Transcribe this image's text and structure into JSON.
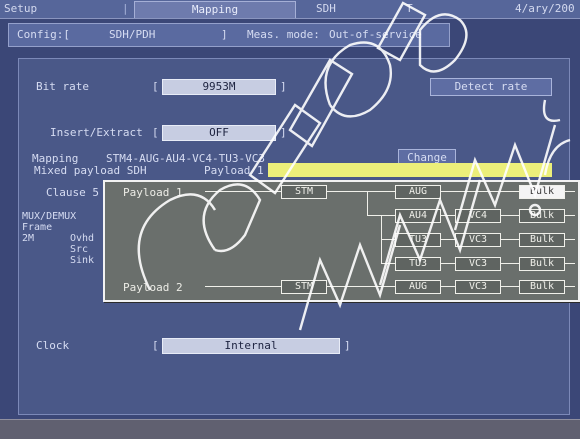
{
  "tabs": {
    "setup": "Setup",
    "mapping": "Mapping",
    "sdh": "SDH",
    "t": "T",
    "date_fragment": "4/ary/200"
  },
  "config_bar": {
    "config_label": "Config:[",
    "config_value": "SDH/PDH",
    "config_close": "]",
    "meas_label": "Meas. mode:",
    "meas_value": "Out-of-service"
  },
  "fields": {
    "bit_rate": {
      "label": "Bit rate",
      "value": "9953M",
      "bracket_open": "[",
      "bracket_close": "]"
    },
    "detect_button": "Detect rate",
    "insert_extract": {
      "label": "Insert/Extract",
      "value": "OFF",
      "bracket_open": "[",
      "bracket_close": "]"
    },
    "mapping": {
      "label": "Mapping",
      "value": "STM4-AUG-AU4-VC4-TU3-VC3",
      "change_button": "Change"
    },
    "mixed_payload": "Mixed payload SDH",
    "payload_selected": "Payload 1",
    "clause_label": "Clause 5",
    "side_labels": [
      "MUX/DEMUX",
      "Frame",
      "2M",
      "Ovhd",
      "Src",
      "Sink"
    ],
    "clock": {
      "label": "Clock",
      "value": "Internal",
      "bracket_open": "[",
      "bracket_close": "]"
    }
  },
  "popup": {
    "payload1_label": "Payload 1",
    "payload2_label": "Payload 2",
    "node_labels": {
      "stm": "STM",
      "aug": "AUG",
      "au4": "AU4",
      "vc4": "VC4",
      "tu3": "TU3",
      "vc3": "VC3",
      "bulk": "Bulk"
    }
  }
}
